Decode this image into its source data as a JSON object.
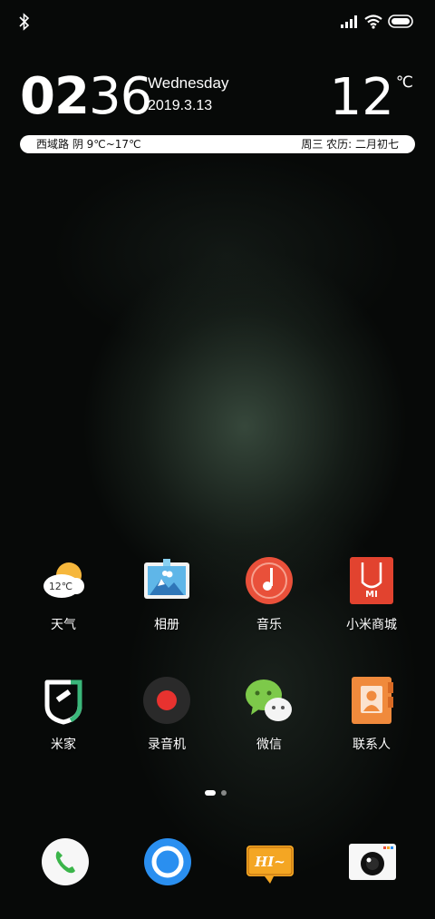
{
  "status": {
    "bluetooth_icon": "bluetooth-icon",
    "signal_icon": "signal-icon",
    "wifi_icon": "wifi-icon",
    "battery_icon": "battery-icon"
  },
  "clock": {
    "hours": "02",
    "minutes": "36",
    "weekday": "Wednesday",
    "date": "2019.3.13",
    "temperature": "12",
    "temp_unit": "℃"
  },
  "info": {
    "left": "西域路 阴 9℃~17℃",
    "right": "周三 农历: 二月初七"
  },
  "apps": [
    {
      "label": "天气",
      "icon": "weather-icon",
      "badge": "12℃"
    },
    {
      "label": "相册",
      "icon": "gallery-icon"
    },
    {
      "label": "音乐",
      "icon": "music-icon"
    },
    {
      "label": "小米商城",
      "icon": "mi-store-icon",
      "badge": "MI"
    },
    {
      "label": "米家",
      "icon": "mi-home-icon"
    },
    {
      "label": "录音机",
      "icon": "recorder-icon"
    },
    {
      "label": "微信",
      "icon": "wechat-icon"
    },
    {
      "label": "联系人",
      "icon": "contacts-icon"
    }
  ],
  "pages": {
    "count": 2,
    "current": 1
  },
  "dock": [
    {
      "icon": "phone-icon"
    },
    {
      "icon": "browser-icon"
    },
    {
      "icon": "messages-icon",
      "text": "HI~"
    },
    {
      "icon": "camera-icon"
    }
  ],
  "colors": {
    "music": "#e9503a",
    "store": "#e2432f",
    "contacts": "#f08a3c",
    "wechat": "#7dc94a",
    "browser": "#2a8ff0",
    "phone_green": "#3bb54a",
    "messages": "#f4a623"
  }
}
